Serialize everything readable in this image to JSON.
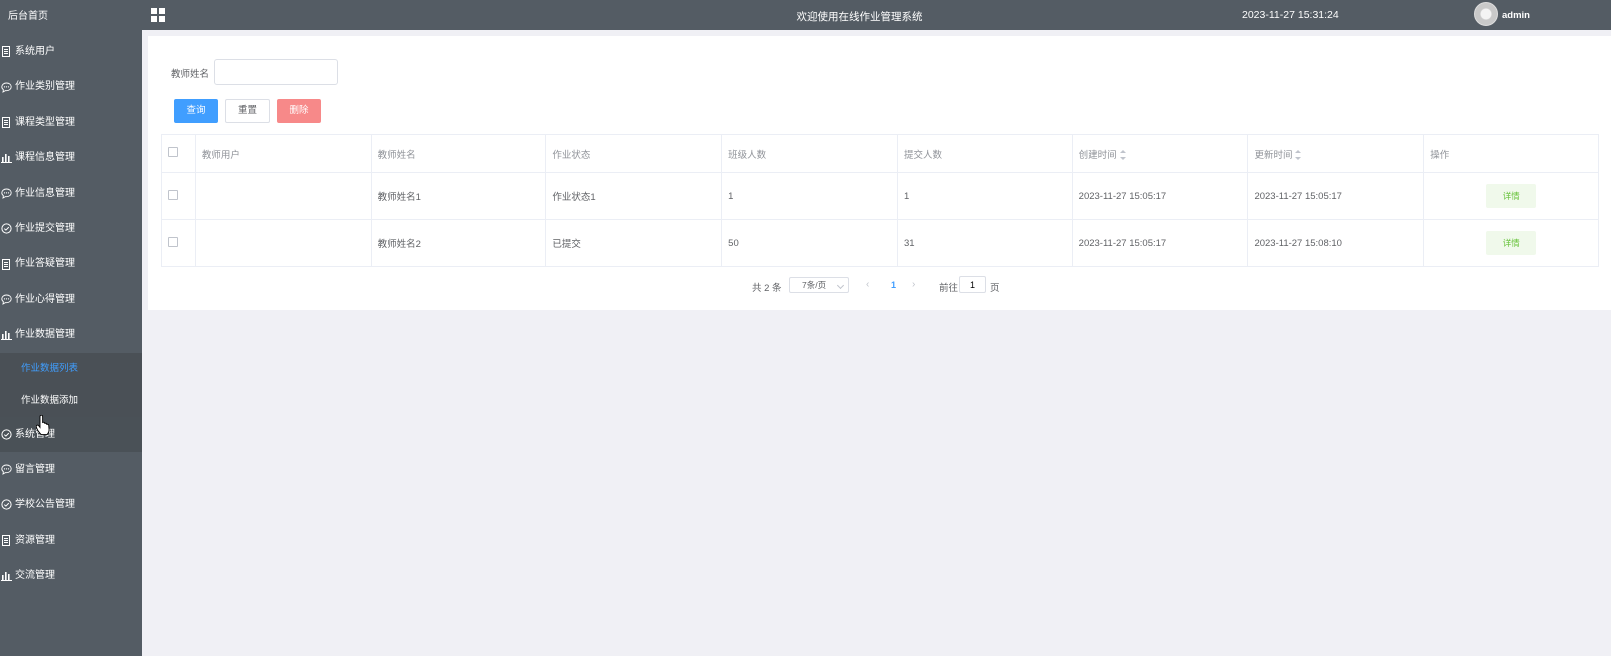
{
  "header": {
    "title": "欢迎使用在线作业管理系统",
    "datetime": "2023-11-27 15:31:24",
    "username": "admin"
  },
  "sidebar": {
    "home": "后台首页",
    "items": [
      {
        "label": "系统用户",
        "icon": "document-icon"
      },
      {
        "label": "作业类别管理",
        "icon": "chat-icon"
      },
      {
        "label": "课程类型管理",
        "icon": "document-icon"
      },
      {
        "label": "课程信息管理",
        "icon": "bar-chart-icon"
      },
      {
        "label": "作业信息管理",
        "icon": "chat-icon"
      },
      {
        "label": "作业提交管理",
        "icon": "check-circle-icon"
      },
      {
        "label": "作业答疑管理",
        "icon": "document-icon"
      },
      {
        "label": "作业心得管理",
        "icon": "chat-icon"
      },
      {
        "label": "作业数据管理",
        "icon": "bar-chart-icon"
      }
    ],
    "submenu": [
      {
        "label": "作业数据列表",
        "active": true
      },
      {
        "label": "作业数据添加",
        "active": false
      }
    ],
    "items2": [
      {
        "label": "系统管理",
        "icon": "check-circle-icon"
      },
      {
        "label": "留言管理",
        "icon": "chat-icon"
      },
      {
        "label": "学校公告管理",
        "icon": "check-circle-icon"
      },
      {
        "label": "资源管理",
        "icon": "document-icon"
      },
      {
        "label": "交流管理",
        "icon": "bar-chart-icon"
      }
    ]
  },
  "search": {
    "label": "教师姓名",
    "value": ""
  },
  "buttons": {
    "query": "查询",
    "reset": "重置",
    "delete": "删除"
  },
  "table": {
    "columns": [
      "教师用户",
      "教师姓名",
      "作业状态",
      "班级人数",
      "提交人数",
      "创建时间",
      "更新时间",
      "操作"
    ],
    "rows": [
      {
        "teacher_user": "",
        "teacher_name": "教师姓名1",
        "status": "作业状态1",
        "class_size": "1",
        "submitted": "1",
        "created": "2023-11-27 15:05:17",
        "updated": "2023-11-27 15:05:17",
        "action": "详情"
      },
      {
        "teacher_user": "",
        "teacher_name": "教师姓名2",
        "status": "已提交",
        "class_size": "50",
        "submitted": "31",
        "created": "2023-11-27 15:05:17",
        "updated": "2023-11-27 15:08:10",
        "action": "详情"
      }
    ]
  },
  "pagination": {
    "total": "共 2 条",
    "page_size": "7条/页",
    "current": "1",
    "goto_label": "前往",
    "jump_value": "1",
    "page_suffix": "页"
  },
  "colors": {
    "sidebar_bg": "#545c64",
    "active": "#409eff",
    "danger": "#f78989",
    "success_text": "#67c23a"
  }
}
